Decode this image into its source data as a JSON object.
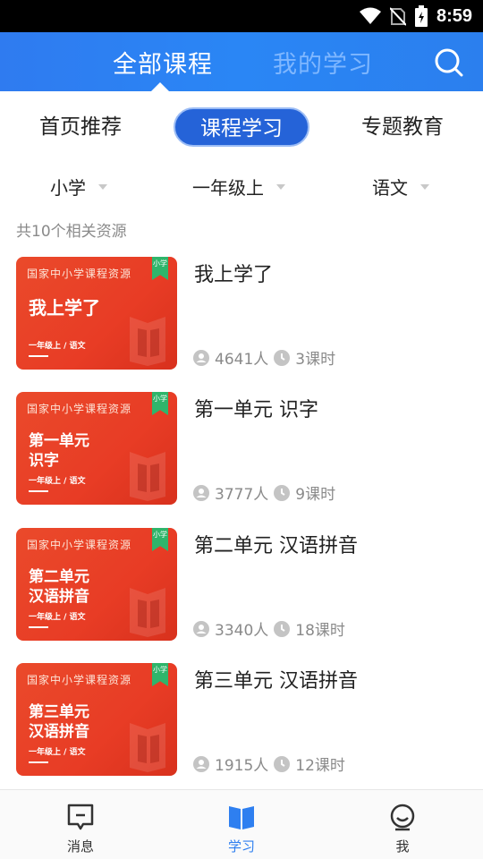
{
  "status_bar": {
    "time": "8:59"
  },
  "header": {
    "tabs": [
      {
        "label": "全部课程",
        "active": true
      },
      {
        "label": "我的学习",
        "active": false
      }
    ]
  },
  "subtabs": [
    {
      "label": "首页推荐",
      "active": false
    },
    {
      "label": "课程学习",
      "active": true
    },
    {
      "label": "专题教育",
      "active": false
    }
  ],
  "filters": [
    {
      "label": "小学"
    },
    {
      "label": "一年级上"
    },
    {
      "label": "语文"
    }
  ],
  "result_count": "共10个相关资源",
  "courses": [
    {
      "title": "我上学了",
      "thumb_brand": "国家中小学课程资源",
      "thumb_badge": "小学",
      "thumb_lines": [
        "我上学了"
      ],
      "thumb_sub": "一年级上 / 语文",
      "learners": "4641人",
      "hours": "3课时"
    },
    {
      "title": "第一单元 识字",
      "thumb_brand": "国家中小学课程资源",
      "thumb_badge": "小学",
      "thumb_lines": [
        "第一单元",
        "识字"
      ],
      "thumb_sub": "一年级上 / 语文",
      "learners": "3777人",
      "hours": "9课时"
    },
    {
      "title": "第二单元 汉语拼音",
      "thumb_brand": "国家中小学课程资源",
      "thumb_badge": "小学",
      "thumb_lines": [
        "第二单元",
        "汉语拼音"
      ],
      "thumb_sub": "一年级上 / 语文",
      "learners": "3340人",
      "hours": "18课时"
    },
    {
      "title": "第三单元 汉语拼音",
      "thumb_brand": "国家中小学课程资源",
      "thumb_badge": "小学",
      "thumb_lines": [
        "第三单元",
        "汉语拼音"
      ],
      "thumb_sub": "一年级上 / 语文",
      "learners": "1915人",
      "hours": "12课时"
    }
  ],
  "bottom_nav": [
    {
      "label": "消息",
      "icon": "message-icon",
      "active": false
    },
    {
      "label": "学习",
      "icon": "book-icon",
      "active": true
    },
    {
      "label": "我",
      "icon": "profile-icon",
      "active": false
    }
  ],
  "colors": {
    "primary": "#2563d8",
    "header_blue": "#2a86f5",
    "thumb_red": "#e83c25",
    "badge_green": "#2fb56b",
    "muted_text": "#8a8a8a"
  }
}
